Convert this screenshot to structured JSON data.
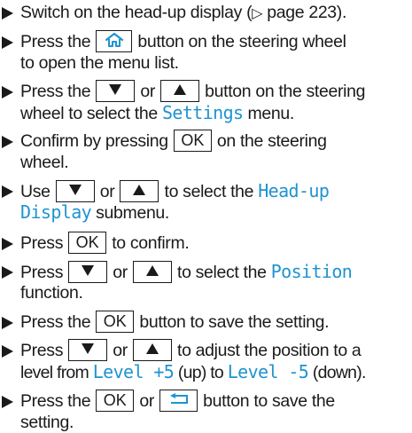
{
  "keys": {
    "ok": "OK"
  },
  "steps": [
    {
      "a": "Switch on the head-up display (",
      "ref_mark": "▷",
      "b": " page 223)."
    },
    {
      "a": "Press the ",
      "b": " button on the steering wheel",
      "c": "to open the menu list.",
      "home_key_icon": "home-icon"
    },
    {
      "a": "Press the ",
      "or": " or ",
      "b": " button on the steering",
      "c": "wheel to select the ",
      "menu": "Settings",
      "d": " menu.",
      "down_key_icon": "down-triangle-icon",
      "up_key_icon": "up-triangle-icon"
    },
    {
      "a": "Confirm by pressing ",
      "b": " on the steering",
      "c": "wheel."
    },
    {
      "a": "Use ",
      "or": " or ",
      "b": " to select the ",
      "menu1": "Head-up",
      "menu2": "Display",
      "c": " submenu."
    },
    {
      "a": "Press ",
      "b": " to confirm."
    },
    {
      "a": "Press ",
      "or": " or ",
      "b": " to select the ",
      "menu": "Position",
      "c": "function."
    },
    {
      "a": "Press the ",
      "b": " button to save the setting."
    },
    {
      "a": "Press ",
      "or": " or ",
      "b": " to adjust the position to a",
      "c": "level from ",
      "menu1": "Level +5",
      "d": " (up) to ",
      "menu2": "Level -5",
      "e": " (down)."
    },
    {
      "a": "Press the ",
      "or": " or ",
      "b": " button to save the",
      "c": "setting.",
      "back_key_icon": "back-icon"
    }
  ]
}
